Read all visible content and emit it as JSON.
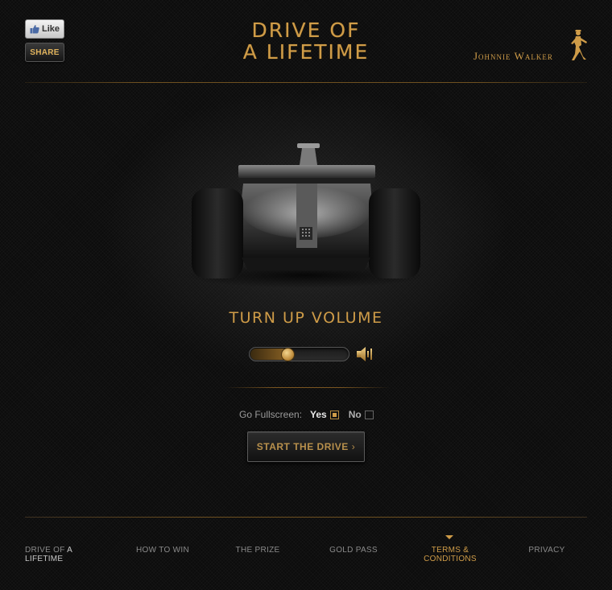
{
  "social": {
    "like_label": "Like",
    "share_label": "SHARE"
  },
  "logo": {
    "title_line1": "DRIVE OF",
    "title_line2": "A LIFETIME",
    "brand": "Johnnie Walker"
  },
  "volume": {
    "heading": "TURN UP VOLUME",
    "level": 0.38
  },
  "fullscreen": {
    "label": "Go Fullscreen:",
    "yes_label": "Yes",
    "no_label": "No",
    "selected": "Yes"
  },
  "start": {
    "label": "START THE DRIVE",
    "chevron": "›"
  },
  "nav": {
    "item1_prefix": "DRIVE OF ",
    "item1_highlight": "A LIFETIME",
    "item2": "HOW TO WIN",
    "item3": "THE PRIZE",
    "item4": "GOLD PASS",
    "item5_line1": "TERMS &",
    "item5_line2": "CONDITIONS",
    "item6": "PRIVACY"
  },
  "colors": {
    "gold": "#cf9c48",
    "background": "#0c0c0c",
    "muted_text": "#8a8a8a"
  },
  "icons": {
    "like": "thumbs-up-icon",
    "speaker": "speaker-icon",
    "brand_mark": "striding-man-icon",
    "active_nav": "triangle-down-icon"
  }
}
